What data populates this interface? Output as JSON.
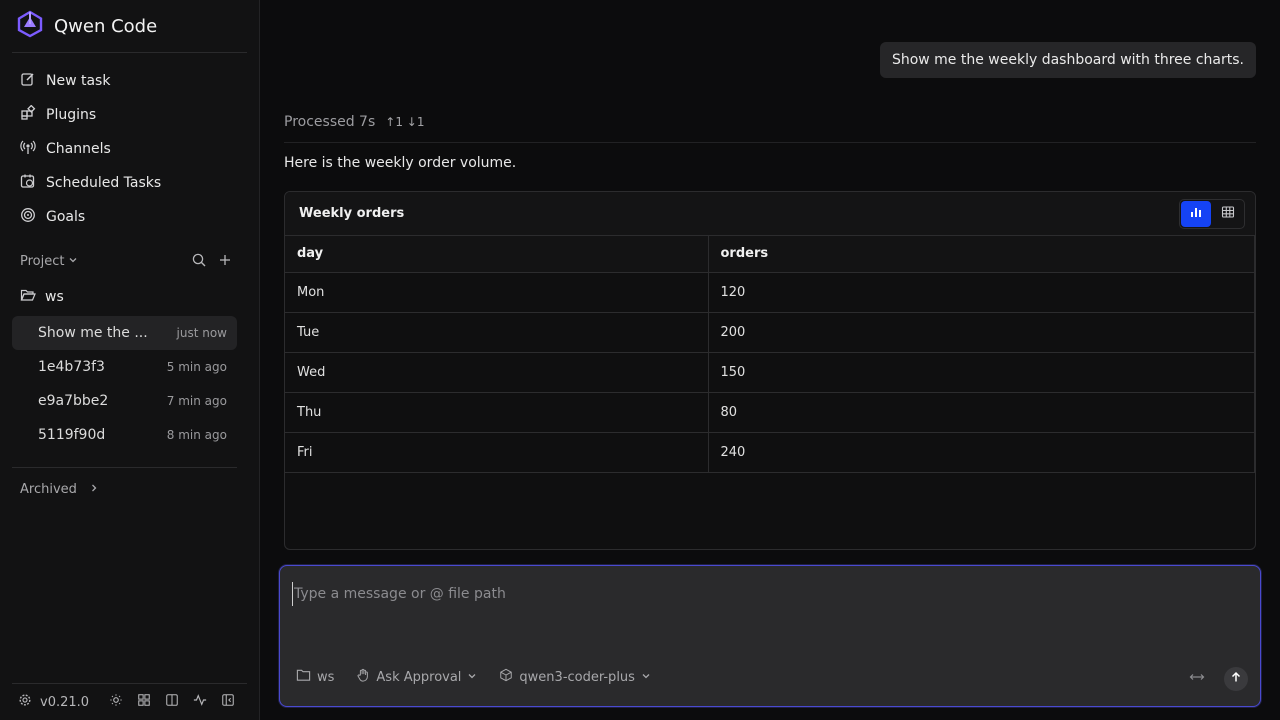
{
  "app": {
    "title": "Qwen Code",
    "version": "v0.21.0"
  },
  "nav": [
    {
      "label": "New task",
      "icon": "edit-icon"
    },
    {
      "label": "Plugins",
      "icon": "plugins-icon"
    },
    {
      "label": "Channels",
      "icon": "broadcast-icon"
    },
    {
      "label": "Scheduled Tasks",
      "icon": "calendar-clock-icon"
    },
    {
      "label": "Goals",
      "icon": "target-icon"
    }
  ],
  "project": {
    "label": "Project",
    "folder": "ws"
  },
  "threads": [
    {
      "title": "Show me the ...",
      "time": "just now"
    },
    {
      "title": "1e4b73f3",
      "time": "5 min ago"
    },
    {
      "title": "e9a7bbe2",
      "time": "7 min ago"
    },
    {
      "title": "5119f90d",
      "time": "8 min ago"
    }
  ],
  "archived_label": "Archived",
  "chat": {
    "user_message": "Show me the weekly dashboard with three charts.",
    "processed": "Processed 7s",
    "tokens": "↑1 ↓1",
    "intro": "Here is the weekly order volume."
  },
  "card": {
    "title": "Weekly orders",
    "columns": [
      "day",
      "orders"
    ],
    "rows": [
      [
        "Mon",
        "120"
      ],
      [
        "Tue",
        "200"
      ],
      [
        "Wed",
        "150"
      ],
      [
        "Thu",
        "80"
      ],
      [
        "Fri",
        "240"
      ]
    ]
  },
  "composer": {
    "placeholder": "Type a message or @ file path",
    "folder": "ws",
    "approval": "Ask Approval",
    "model": "qwen3-coder-plus"
  },
  "colors": {
    "accent": "#1543f5",
    "brand_purple": "#7c5cff",
    "focus_border": "#4a4ad0"
  }
}
